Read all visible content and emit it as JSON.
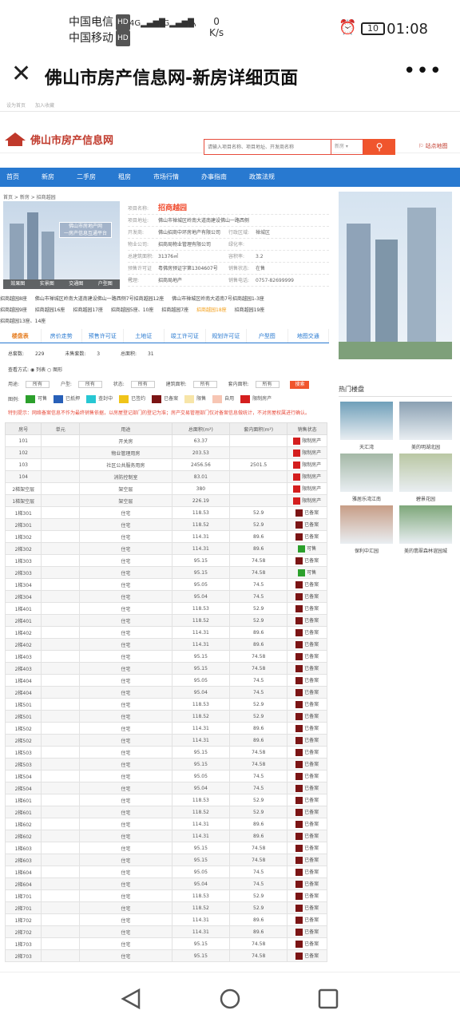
{
  "status_bar": {
    "carrier1": "中国电信",
    "carrier2": "中国移动",
    "hd": "HD",
    "speed_value": "0",
    "speed_unit": "K/s",
    "battery": "10",
    "time": "01:08"
  },
  "title_bar": {
    "title": "佛山市房产信息网-新房详细页面"
  },
  "site": {
    "top_links": [
      "设为首页",
      "加入收藏"
    ],
    "logo_text": "佛山市房产信息网",
    "search_placeholder": "请输入项目名称、项目地址、开发商名称",
    "search_select": "新房",
    "sitemap": "站点地图",
    "nav": [
      "首页",
      "新房",
      "二手房",
      "租房",
      "市场行情",
      "办事指南",
      "政策法规"
    ],
    "breadcrumb": "首页 > 新房 > 招商越园"
  },
  "photo": {
    "banner_line1": "佛山市房地产网",
    "banner_line2": "一房产信息互通平台",
    "tabs": [
      "效果图",
      "实景图",
      "交通图",
      "户型图"
    ]
  },
  "project": {
    "name_label": "项目名称:",
    "name": "招商越园",
    "addr_label": "项目地址:",
    "addr": "佛山市禅城区岭南大道南建设佛山一路西侧",
    "dev_label": "开发商:",
    "dev": "佛山招商中环房地产有限公司",
    "district_label": "行政区域:",
    "district": "禅城区",
    "mgmt_label": "物业公司:",
    "mgmt": "招商局物业管理有限公司",
    "green_label": "绿化率:",
    "green": "",
    "area_label": "总建筑面积:",
    "area": "31376㎡",
    "far_label": "容积率:",
    "far": "3.2",
    "permit_label": "预售许可证号:",
    "permit": "粤佛房预证字第1304607号",
    "status_label": "销售状态:",
    "status": "在售",
    "agent_label": "代理:",
    "agent": "招商局地产",
    "phone_label": "销售电话:",
    "phone": "0757-82699999"
  },
  "links": {
    "items": [
      "招商越园8座",
      "佛山市禅城区岭南大道南建设佛山一路西侧7号招商越园12座",
      "佛山市禅城区岭南大道南7号招商越园1-3座",
      "招商越园9座",
      "招商越园16座",
      "招商越园17座",
      "招商越园5座、10座",
      "招商越园7座",
      "招商越园18座",
      "招商越园19座"
    ],
    "last": "招商越园13座、14座"
  },
  "tabs": [
    "楼盘表",
    "房价走势",
    "预售许可证",
    "土地证",
    "竣工许可证",
    "规划许可证",
    "户型图",
    "地图交通"
  ],
  "stats": {
    "total_label": "总套数:",
    "total": "229",
    "sold_label": "未售套数:",
    "sold": "3",
    "rate_label": "总面积:",
    "rate": "31"
  },
  "mode": {
    "label": "查看方式:",
    "opt1": "列表",
    "opt2": "图形"
  },
  "filters": {
    "labels": [
      "用途:",
      "户型:",
      "状态:",
      "建筑面积:",
      "套内面积:"
    ],
    "all": "所有",
    "button": "搜索"
  },
  "legend": {
    "label": "图例:",
    "items": [
      {
        "name": "可售",
        "color": "#2ca02c"
      },
      {
        "name": "已抵押",
        "color": "#2860b8"
      },
      {
        "name": "查封中",
        "color": "#27c7d3"
      },
      {
        "name": "已签约",
        "color": "#f0c419"
      },
      {
        "name": "已备案",
        "color": "#7b1414"
      },
      {
        "name": "限售",
        "color": "#f7e5a8"
      },
      {
        "name": "自用",
        "color": "#f7c6b4"
      },
      {
        "name": "限制房产",
        "color": "#d41e1e"
      }
    ]
  },
  "note": "特别提示：网络备案信息不作为最终销售依据，以房屋登记部门的登记为准；房产交易管理部门仅对备案信息做统计，不对房屋权属进行确认。",
  "table": {
    "headers": [
      "房号",
      "单元",
      "用途",
      "总面积(m²)",
      "套内面积(m²)",
      "销售状态"
    ],
    "rows": [
      [
        "101",
        "",
        "开关房",
        "63.37",
        "",
        "限制房产"
      ],
      [
        "102",
        "",
        "物业管理用房",
        "203.53",
        "",
        "限制房产"
      ],
      [
        "103",
        "",
        "社区公共服务用房",
        "2456.56",
        "2501.5",
        "限制房产"
      ],
      [
        "104",
        "",
        "消防控制室",
        "83.01",
        "",
        "限制房产"
      ],
      [
        "2梯架空层",
        "",
        "架空层",
        "380",
        "",
        "限制房产"
      ],
      [
        "1梯架空层",
        "",
        "架空层",
        "226.19",
        "",
        "限制房产"
      ],
      [
        "1梯301",
        "",
        "住宅",
        "118.53",
        "52.9",
        "已备案"
      ],
      [
        "2梯301",
        "",
        "住宅",
        "118.52",
        "52.9",
        "已备案"
      ],
      [
        "1梯302",
        "",
        "住宅",
        "114.31",
        "89.6",
        "已备案"
      ],
      [
        "2梯302",
        "",
        "住宅",
        "114.31",
        "89.6",
        "可售"
      ],
      [
        "1梯303",
        "",
        "住宅",
        "95.15",
        "74.58",
        "已备案"
      ],
      [
        "2梯303",
        "",
        "住宅",
        "95.15",
        "74.58",
        "可售"
      ],
      [
        "1梯304",
        "",
        "住宅",
        "95.05",
        "74.5",
        "已备案"
      ],
      [
        "2梯304",
        "",
        "住宅",
        "95.04",
        "74.5",
        "已备案"
      ],
      [
        "1梯401",
        "",
        "住宅",
        "118.53",
        "52.9",
        "已备案"
      ],
      [
        "2梯401",
        "",
        "住宅",
        "118.52",
        "52.9",
        "已备案"
      ],
      [
        "1梯402",
        "",
        "住宅",
        "114.31",
        "89.6",
        "已备案"
      ],
      [
        "2梯402",
        "",
        "住宅",
        "114.31",
        "89.6",
        "已备案"
      ],
      [
        "1梯403",
        "",
        "住宅",
        "95.15",
        "74.58",
        "已备案"
      ],
      [
        "2梯403",
        "",
        "住宅",
        "95.15",
        "74.58",
        "已备案"
      ],
      [
        "1梯404",
        "",
        "住宅",
        "95.05",
        "74.5",
        "已备案"
      ],
      [
        "2梯404",
        "",
        "住宅",
        "95.04",
        "74.5",
        "已备案"
      ],
      [
        "1梯501",
        "",
        "住宅",
        "118.53",
        "52.9",
        "已备案"
      ],
      [
        "2梯501",
        "",
        "住宅",
        "118.52",
        "52.9",
        "已备案"
      ],
      [
        "1梯502",
        "",
        "住宅",
        "114.31",
        "89.6",
        "已备案"
      ],
      [
        "2梯502",
        "",
        "住宅",
        "114.31",
        "89.6",
        "已备案"
      ],
      [
        "1梯503",
        "",
        "住宅",
        "95.15",
        "74.58",
        "已备案"
      ],
      [
        "2梯503",
        "",
        "住宅",
        "95.15",
        "74.58",
        "已备案"
      ],
      [
        "1梯504",
        "",
        "住宅",
        "95.05",
        "74.5",
        "已备案"
      ],
      [
        "2梯504",
        "",
        "住宅",
        "95.04",
        "74.5",
        "已备案"
      ],
      [
        "1梯601",
        "",
        "住宅",
        "118.53",
        "52.9",
        "已备案"
      ],
      [
        "2梯601",
        "",
        "住宅",
        "118.52",
        "52.9",
        "已备案"
      ],
      [
        "1梯602",
        "",
        "住宅",
        "114.31",
        "89.6",
        "已备案"
      ],
      [
        "2梯602",
        "",
        "住宅",
        "114.31",
        "89.6",
        "已备案"
      ],
      [
        "1梯603",
        "",
        "住宅",
        "95.15",
        "74.58",
        "已备案"
      ],
      [
        "2梯603",
        "",
        "住宅",
        "95.15",
        "74.58",
        "已备案"
      ],
      [
        "1梯604",
        "",
        "住宅",
        "95.05",
        "74.5",
        "已备案"
      ],
      [
        "2梯604",
        "",
        "住宅",
        "95.04",
        "74.5",
        "已备案"
      ],
      [
        "1梯701",
        "",
        "住宅",
        "118.53",
        "52.9",
        "已备案"
      ],
      [
        "2梯701",
        "",
        "住宅",
        "118.52",
        "52.9",
        "已备案"
      ],
      [
        "1梯702",
        "",
        "住宅",
        "114.31",
        "89.6",
        "已备案"
      ],
      [
        "2梯702",
        "",
        "住宅",
        "114.31",
        "89.6",
        "已备案"
      ],
      [
        "1梯703",
        "",
        "住宅",
        "95.15",
        "74.58",
        "已备案"
      ],
      [
        "2梯703",
        "",
        "住宅",
        "95.15",
        "74.58",
        "已备案"
      ]
    ]
  },
  "sidebar": {
    "hot_title": "热门楼盘",
    "hot": [
      {
        "name": "天汇湾",
        "color": "#6f9fb9"
      },
      {
        "name": "美的明湖北园",
        "color": "#8aa0b2"
      },
      {
        "name": "雅居乐湾江南",
        "color": "#a4b8a6"
      },
      {
        "name": "碧景花园",
        "color": "#b9c7a3"
      },
      {
        "name": "保利中汇园",
        "color": "#c79d86"
      },
      {
        "name": "美的翡翠森林谊园城",
        "color": "#7ea77a"
      }
    ]
  },
  "status_colors": {
    "已备案": "#7b1414",
    "可售": "#2ca02c",
    "限制房产": "#d41e1e"
  }
}
